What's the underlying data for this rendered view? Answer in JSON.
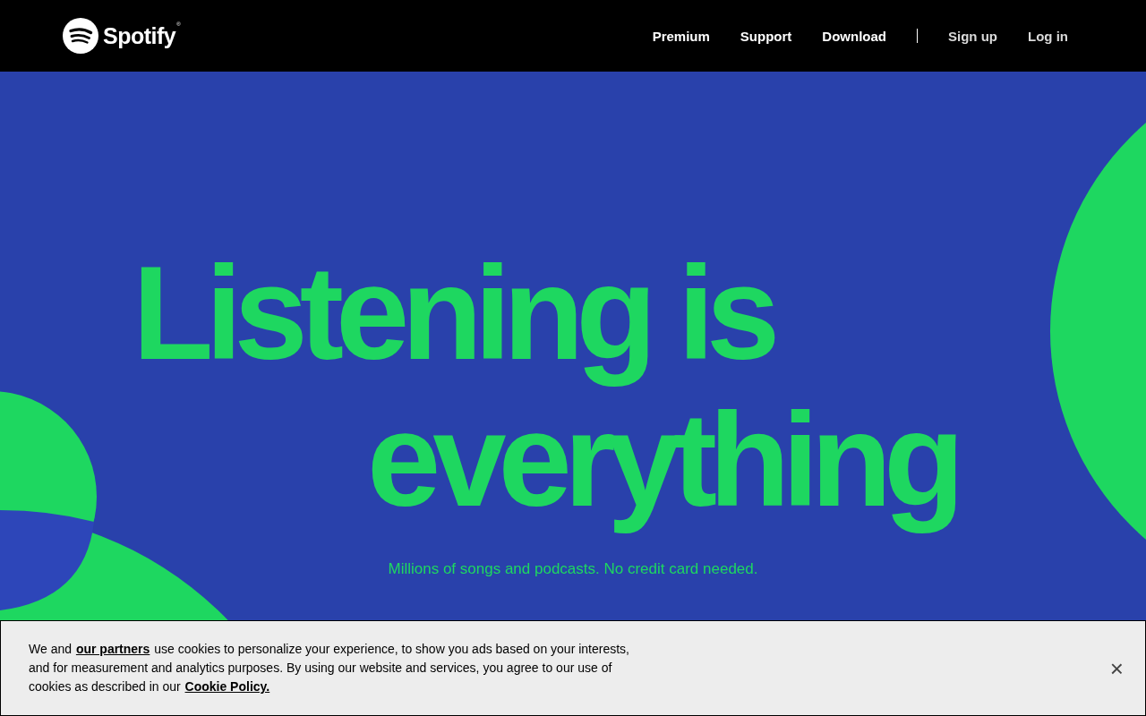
{
  "header": {
    "logo": {
      "wordmark": "Spotify",
      "mark": "®"
    },
    "nav": [
      {
        "label": "Premium",
        "kind": "primary"
      },
      {
        "label": "Support",
        "kind": "primary"
      },
      {
        "label": "Download",
        "kind": "primary"
      },
      {
        "kind": "divider"
      },
      {
        "label": "Sign up",
        "kind": "secondary"
      },
      {
        "label": "Log in",
        "kind": "secondary"
      }
    ]
  },
  "hero": {
    "headline_lines": [
      "Listening is",
      "everything"
    ],
    "subtitle": "Millions of songs and podcasts. No credit card needed."
  },
  "cookie_banner": {
    "segments": [
      {
        "kind": "text",
        "text": "We and "
      },
      {
        "kind": "link",
        "text": "our partners"
      },
      {
        "kind": "text",
        "text": " use cookies to personalize your experience, to show you ads based on your interests, and for measurement and analytics purposes. By using our website and services, you agree to our use of cookies as described in our "
      },
      {
        "kind": "link",
        "text": "Cookie Policy."
      }
    ],
    "close": "×"
  }
}
